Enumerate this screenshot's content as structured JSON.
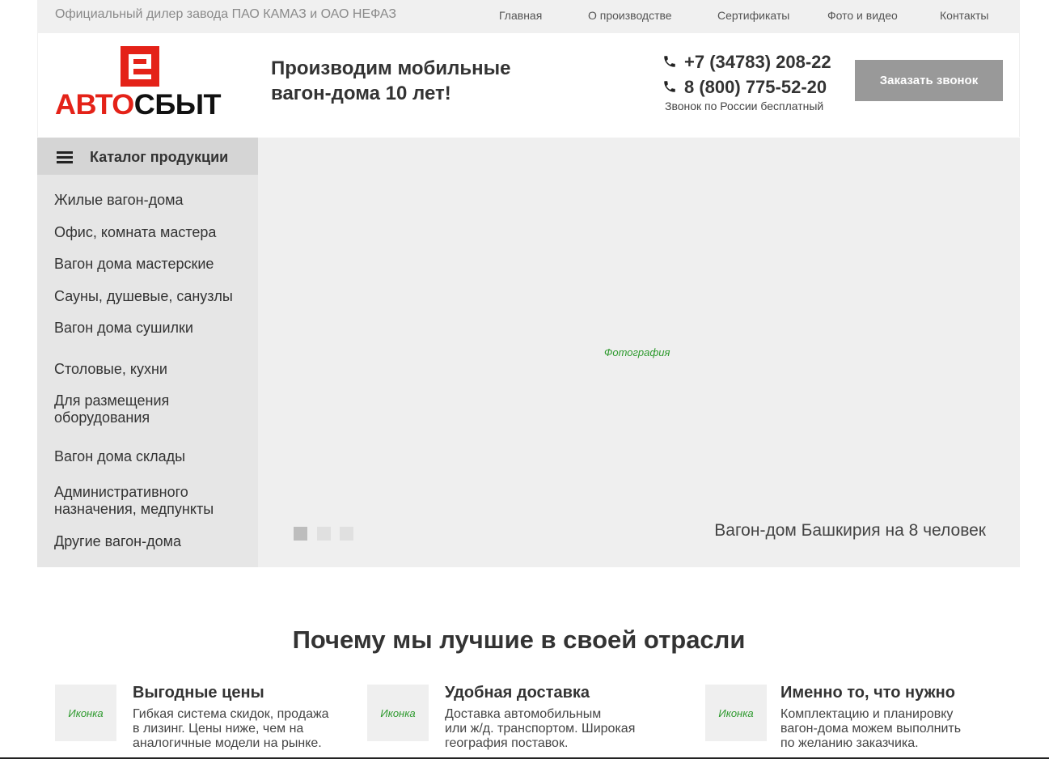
{
  "topbar": {
    "dealer": "Официальный дилер завода ПАО КАМАЗ и ОАО НЕФАЗ",
    "nav": [
      "Главная",
      "О производстве",
      "Сертификаты",
      "Фото и видео",
      "Контакты"
    ]
  },
  "header": {
    "logo_part1": "АВТО",
    "logo_part2": "СБЫТ",
    "slogan_line1": "Производим мобильные",
    "slogan_line2": "вагон-дома 10 лет!",
    "phone1": "+7 (34783) 208-22",
    "phone2": "8 (800) 775-52-20",
    "free_call": "Звонок по России бесплатный",
    "call_button": "Заказать звонок",
    "colors": {
      "brand_red": "#e42218",
      "button_gray": "#999999"
    }
  },
  "catalog": {
    "title": "Каталог продукции",
    "items": [
      {
        "line1": "Жилые вагон-дома",
        "line2": ""
      },
      {
        "line1": "Офис, комната мастера",
        "line2": ""
      },
      {
        "line1": "Вагон дома мастерские",
        "line2": ""
      },
      {
        "line1": "Сауны, душевые, санузлы",
        "line2": ""
      },
      {
        "line1": "Вагон дома сушилки",
        "line2": ""
      },
      {
        "line1": "Столовые, кухни",
        "line2": ""
      },
      {
        "line1": "Для размещения",
        "line2": "оборудования"
      },
      {
        "line1": "Вагон дома склады",
        "line2": ""
      },
      {
        "line1": "Административного",
        "line2": "назначения, медпункты"
      },
      {
        "line1": "Другие вагон-дома",
        "line2": ""
      }
    ]
  },
  "slider": {
    "photo_placeholder": "Фотография",
    "caption": "Вагон-дом Башкирия на 8 человек",
    "slide_count": 3,
    "active_slide": 1
  },
  "advantages": {
    "title": "Почему мы лучшие в своей отрасли",
    "items": [
      {
        "icon": "Иконка",
        "title": "Выгодные цены",
        "text1": "Гибкая система скидок, продажа",
        "text2": "в лизинг. Цены ниже, чем на",
        "text3": "аналогичные модели на рынке."
      },
      {
        "icon": "Иконка",
        "title": "Удобная доставка",
        "text1": "Доставка автомобильным",
        "text2": "или ж/д. транспортом. Широкая",
        "text3": "география поставок."
      },
      {
        "icon": "Иконка",
        "title": "Именно то, что нужно",
        "text1": "Комплектацию и планировку",
        "text2": "вагон-дома можем выполнить",
        "text3": "по желанию заказчика."
      }
    ]
  }
}
